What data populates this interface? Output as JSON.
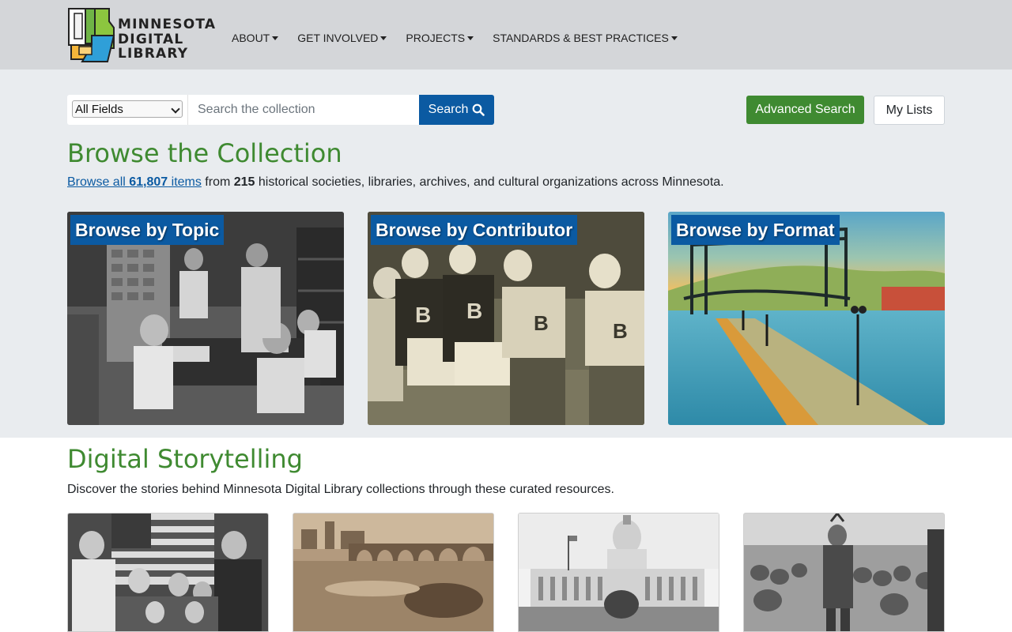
{
  "header": {
    "logo": {
      "lines": [
        "MINNESOTA",
        "DIGITAL",
        "LIBRARY"
      ]
    },
    "nav": [
      {
        "label": "ABOUT"
      },
      {
        "label": "GET INVOLVED"
      },
      {
        "label": "PROJECTS"
      },
      {
        "label": "STANDARDS & BEST PRACTICES"
      }
    ]
  },
  "search": {
    "field_selected": "All Fields",
    "placeholder": "Search the collection",
    "value": "",
    "button_label": "Search",
    "advanced_label": "Advanced Search",
    "lists_label": "My Lists"
  },
  "browse": {
    "title": "Browse the Collection",
    "intro": {
      "link_prefix": "Browse all ",
      "item_count": "61,807",
      "link_suffix": " items",
      "from_text": " from ",
      "org_count": "215",
      "rest_text": " historical societies, libraries, archives, and cultural organizations across Minnesota."
    },
    "cards": [
      {
        "label": "Browse by Topic"
      },
      {
        "label": "Browse by Contributor"
      },
      {
        "label": "Browse by Format"
      }
    ]
  },
  "storytelling": {
    "title": "Digital Storytelling",
    "intro": "Discover the stories behind Minnesota Digital Library collections through these curated resources."
  },
  "colors": {
    "brand_green": "#3f8a31",
    "brand_blue": "#0b5aa2",
    "header_bg": "#d4d6d9",
    "section_bg": "#e9ecef"
  }
}
